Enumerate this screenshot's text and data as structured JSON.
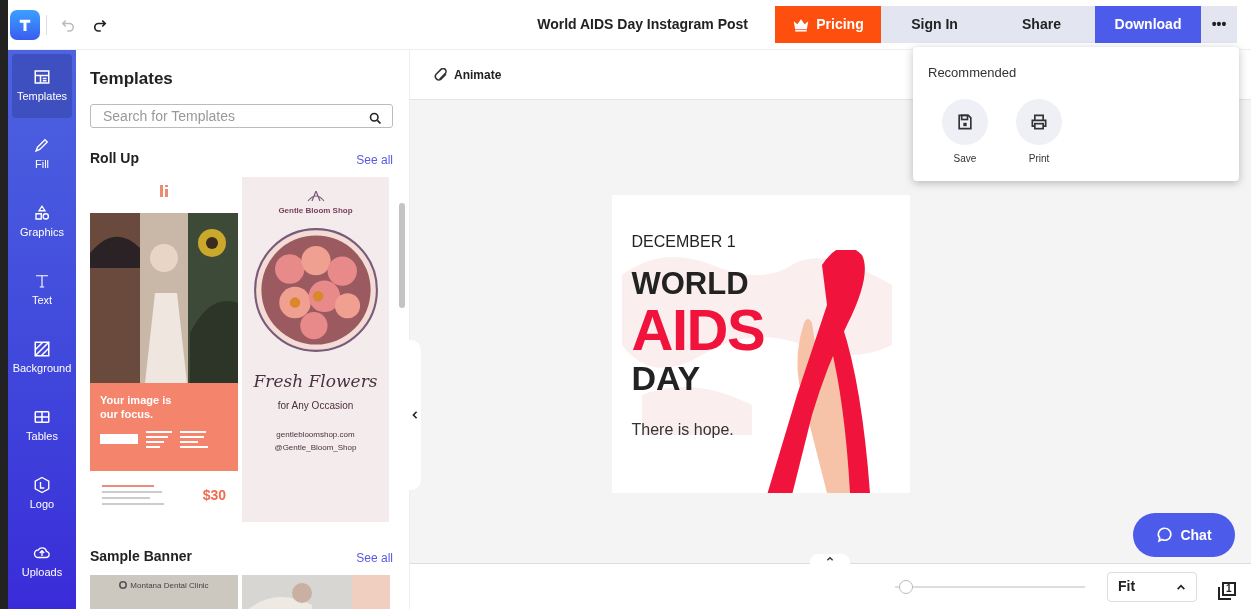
{
  "header": {
    "document_title": "World AIDS Day Instagram Post",
    "buttons": [
      {
        "kind": "pricing",
        "label": "Pricing"
      },
      {
        "kind": "plain",
        "label": "Sign In"
      },
      {
        "kind": "plain",
        "label": "Share"
      },
      {
        "kind": "primary",
        "label": "Download"
      },
      {
        "kind": "more",
        "label": "•••"
      }
    ]
  },
  "rail": [
    {
      "label": "Templates",
      "selected": true
    },
    {
      "label": "Fill",
      "selected": false
    },
    {
      "label": "Graphics",
      "selected": false
    },
    {
      "label": "Text",
      "selected": false
    },
    {
      "label": "Background",
      "selected": false
    },
    {
      "label": "Tables",
      "selected": false
    },
    {
      "label": "Logo",
      "selected": false
    },
    {
      "label": "Uploads",
      "selected": false
    }
  ],
  "panel": {
    "title": "Templates",
    "search": {
      "placeholder": "Search for Templates"
    },
    "sections": [
      {
        "title": "Roll Up",
        "link": "See all"
      },
      {
        "title": "Sample Banner",
        "link": "See all"
      }
    ],
    "rollup_left": {
      "headline": "Your image is our focus.",
      "price": "$30"
    },
    "rollup_right": {
      "shop": "Gentle Bloom Shop",
      "script": "Fresh Flowers",
      "tagline": "for Any Occasion",
      "site": "gentlebloomshop.com",
      "handle": "@Gentle_Bloom_Shop"
    },
    "banner_left": {
      "clinic": "Montana Dental Clinic"
    }
  },
  "toolbar": {
    "animate": "Animate"
  },
  "menu": {
    "title": "Recommended",
    "items": [
      {
        "label": "Save"
      },
      {
        "label": "Print"
      }
    ]
  },
  "design": {
    "date": "DECEMBER 1",
    "line1": "WORLD",
    "line2": "AIDS",
    "line3": "DAY",
    "tagline": "There is hope."
  },
  "bottom": {
    "zoom": {
      "level": 0.06
    },
    "fit": "Fit",
    "page_count": "1"
  },
  "chat": {
    "label": "Chat"
  }
}
